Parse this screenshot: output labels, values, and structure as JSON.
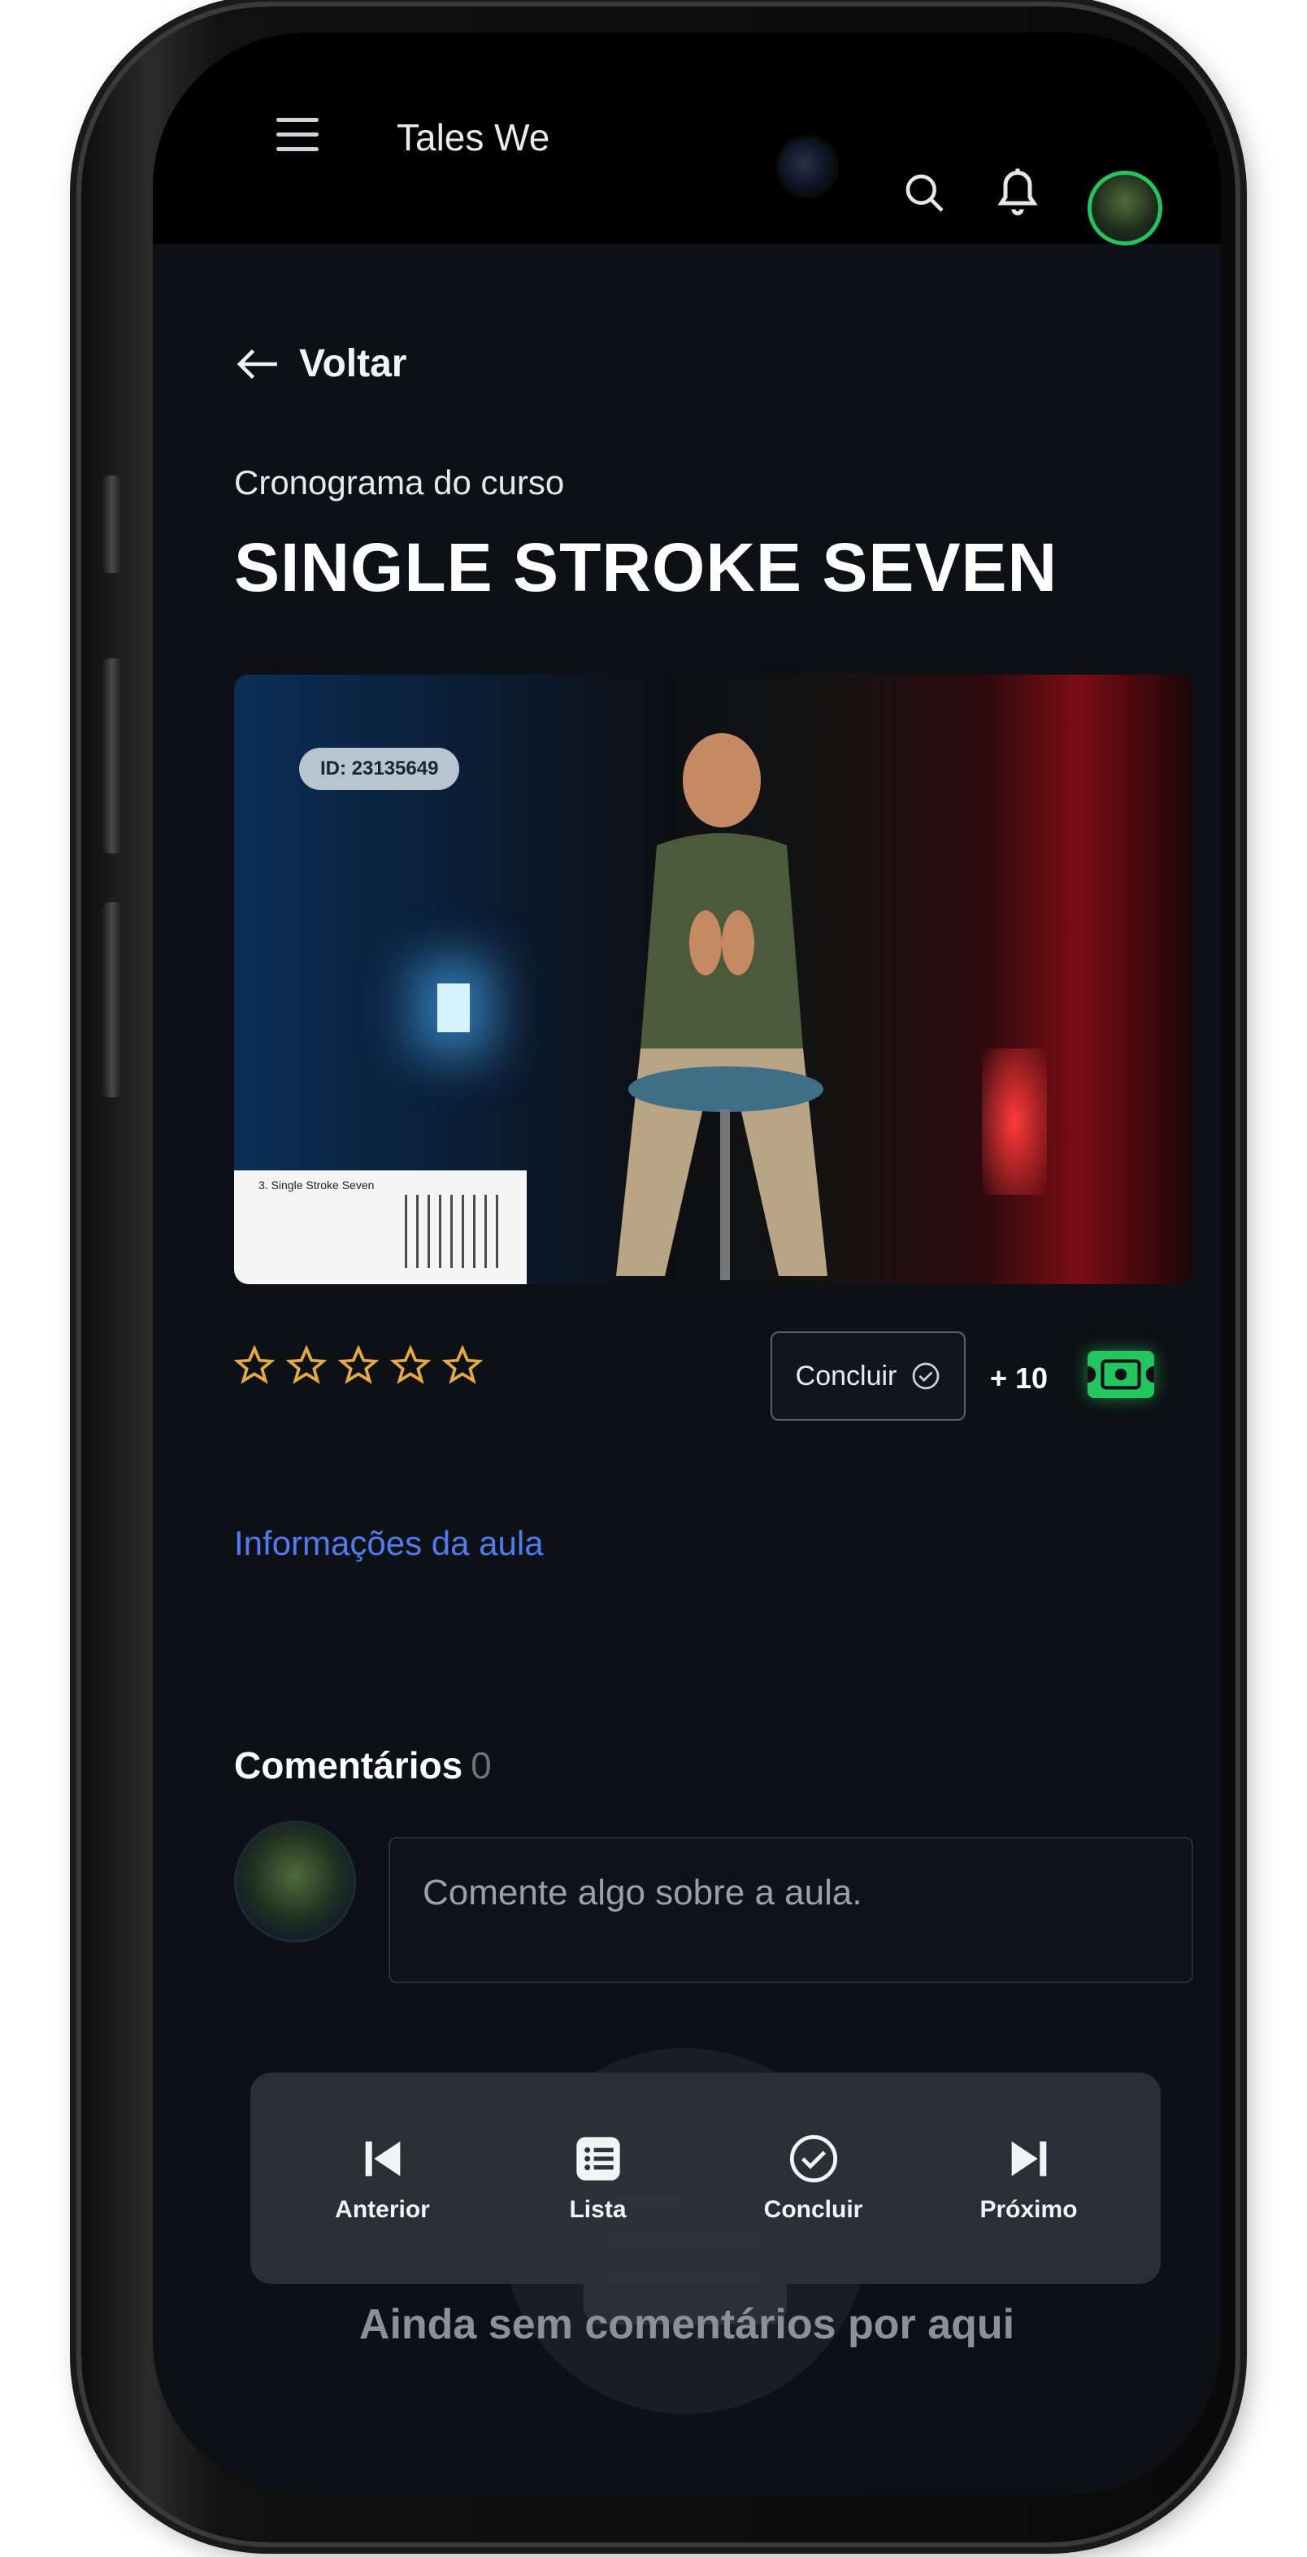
{
  "header": {
    "app_title": "Tales We",
    "menu_icon": "hamburger-menu-icon",
    "search_icon": "search-icon",
    "notifications_icon": "bell-icon"
  },
  "lesson": {
    "back_label": "Voltar",
    "subtitle": "Cronograma do curso",
    "title": "SINGLE STROKE SEVEN",
    "video": {
      "id_badge": "ID: 23135649",
      "sheet_caption": "3. Single Stroke Seven"
    },
    "rating_stars": 0,
    "rating_max": 5,
    "complete_button_label": "Concluir",
    "points": "+ 10",
    "info_link": "Informações da aula"
  },
  "comments": {
    "title": "Comentários",
    "count": "0",
    "input_placeholder": "Comente algo sobre a aula.",
    "empty_text": "Ainda sem comentários por aqui"
  },
  "bottom_nav": {
    "previous": "Anterior",
    "list": "Lista",
    "complete": "Concluir",
    "next": "Próximo"
  },
  "colors": {
    "accent_green": "#22c55e",
    "link_blue": "#4f7cf0",
    "star_gold": "#e6a940",
    "background": "#0d1014"
  }
}
